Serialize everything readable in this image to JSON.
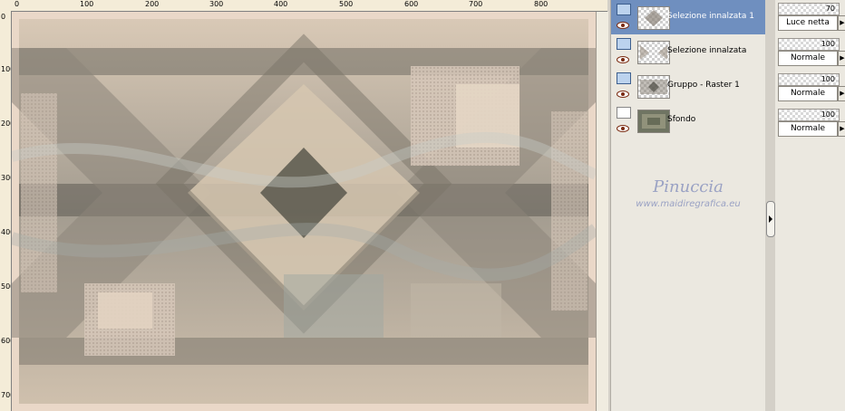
{
  "ruler": {
    "top_labels": [
      "0",
      "100",
      "200",
      "300",
      "400",
      "500",
      "600",
      "700",
      "800"
    ],
    "left_labels": [
      "0",
      "100",
      "200",
      "300",
      "400",
      "500",
      "600",
      "700"
    ]
  },
  "layers": [
    {
      "name": "Selezione innalzata 1",
      "selected": true,
      "icon": "raster-layer-icon",
      "visible": true
    },
    {
      "name": "Selezione innalzata",
      "selected": false,
      "icon": "raster-layer-icon",
      "visible": true
    },
    {
      "name": "Gruppo - Raster 1",
      "selected": false,
      "icon": "group-layer-icon",
      "visible": true
    },
    {
      "name": "Sfondo",
      "selected": false,
      "icon": "background-layer-icon",
      "visible": true
    }
  ],
  "layer_props": [
    {
      "opacity": "70",
      "blend_mode": "Luce netta"
    },
    {
      "opacity": "100",
      "blend_mode": "Normale"
    },
    {
      "opacity": "100",
      "blend_mode": "Normale"
    },
    {
      "opacity": "100",
      "blend_mode": "Normale"
    }
  ],
  "watermark": {
    "name": "Pinuccia",
    "site": "www.maidiregrafica.eu"
  },
  "colors": {
    "selected_row": "#6f8fbf",
    "panel_bg": "#ebe8e0",
    "canvas_bg": "#e9d7c7"
  }
}
